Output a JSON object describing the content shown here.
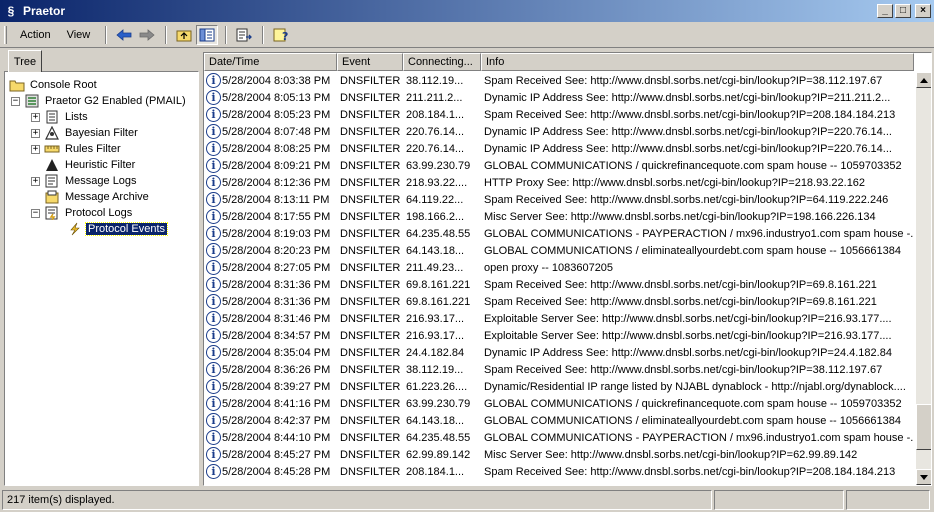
{
  "window": {
    "title": "Praetor",
    "minimize_label": "_",
    "maximize_label": "□",
    "close_label": "×"
  },
  "menu": {
    "action": "Action",
    "view": "View"
  },
  "toolbar_icons": [
    "back-arrow-icon",
    "forward-arrow-icon",
    "up-folder-icon",
    "show-hide-tree-icon",
    "export-list-icon",
    "help-icon"
  ],
  "tree": {
    "tab_label": "Tree",
    "nodes": [
      {
        "label": "Console Root",
        "icon": "folder-icon",
        "level": 0,
        "expander": ""
      },
      {
        "label": "Praetor G2 Enabled (PMAIL)",
        "icon": "server-icon",
        "level": 1,
        "expander": "−"
      },
      {
        "label": "Lists",
        "icon": "list-icon",
        "level": 2,
        "expander": "+"
      },
      {
        "label": "Bayesian Filter",
        "icon": "bayesian-icon",
        "level": 2,
        "expander": "+"
      },
      {
        "label": "Rules Filter",
        "icon": "rules-icon",
        "level": 2,
        "expander": "+"
      },
      {
        "label": "Heuristic Filter",
        "icon": "heuristic-icon",
        "level": 2,
        "expander": ""
      },
      {
        "label": "Message Logs",
        "icon": "log-icon",
        "level": 2,
        "expander": "+"
      },
      {
        "label": "Message Archive",
        "icon": "archive-icon",
        "level": 2,
        "expander": ""
      },
      {
        "label": "Protocol Logs",
        "icon": "protocol-log-icon",
        "level": 2,
        "expander": "−"
      },
      {
        "label": "Protocol Events",
        "icon": "lightning-icon",
        "level": 3,
        "expander": "",
        "selected": true
      }
    ]
  },
  "table": {
    "columns": [
      "Date/Time",
      "Event",
      "Connecting...",
      "Info"
    ],
    "rows": [
      [
        "5/28/2004 8:03:38 PM",
        "DNSFILTER",
        "38.112.19...",
        "Spam Received See: http://www.dnsbl.sorbs.net/cgi-bin/lookup?IP=38.112.197.67"
      ],
      [
        "5/28/2004 8:05:13 PM",
        "DNSFILTER",
        "211.211.2...",
        "Dynamic IP Address See: http://www.dnsbl.sorbs.net/cgi-bin/lookup?IP=211.211.2..."
      ],
      [
        "5/28/2004 8:05:23 PM",
        "DNSFILTER",
        "208.184.1...",
        "Spam Received See: http://www.dnsbl.sorbs.net/cgi-bin/lookup?IP=208.184.184.213"
      ],
      [
        "5/28/2004 8:07:48 PM",
        "DNSFILTER",
        "220.76.14...",
        "Dynamic IP Address See: http://www.dnsbl.sorbs.net/cgi-bin/lookup?IP=220.76.14..."
      ],
      [
        "5/28/2004 8:08:25 PM",
        "DNSFILTER",
        "220.76.14...",
        "Dynamic IP Address See: http://www.dnsbl.sorbs.net/cgi-bin/lookup?IP=220.76.14..."
      ],
      [
        "5/28/2004 8:09:21 PM",
        "DNSFILTER",
        "63.99.230.79",
        "GLOBAL COMMUNICATIONS / quickrefinancequote.com spam house -- 1059703352"
      ],
      [
        "5/28/2004 8:12:36 PM",
        "DNSFILTER",
        "218.93.22....",
        "HTTP Proxy See: http://www.dnsbl.sorbs.net/cgi-bin/lookup?IP=218.93.22.162"
      ],
      [
        "5/28/2004 8:13:11 PM",
        "DNSFILTER",
        "64.119.22...",
        "Spam Received See: http://www.dnsbl.sorbs.net/cgi-bin/lookup?IP=64.119.222.246"
      ],
      [
        "5/28/2004 8:17:55 PM",
        "DNSFILTER",
        "198.166.2...",
        "Misc Server See: http://www.dnsbl.sorbs.net/cgi-bin/lookup?IP=198.166.226.134"
      ],
      [
        "5/28/2004 8:19:03 PM",
        "DNSFILTER",
        "64.235.48.55",
        "GLOBAL COMMUNICATIONS - PAYPERACTION / mx96.industryo1.com spam house -..."
      ],
      [
        "5/28/2004 8:20:23 PM",
        "DNSFILTER",
        "64.143.18...",
        "GLOBAL COMMUNICATIONS / eliminateallyourdebt.com spam house -- 1056661384"
      ],
      [
        "5/28/2004 8:27:05 PM",
        "DNSFILTER",
        "211.49.23...",
        "open proxy -- 1083607205"
      ],
      [
        "5/28/2004 8:31:36 PM",
        "DNSFILTER",
        "69.8.161.221",
        "Spam Received See: http://www.dnsbl.sorbs.net/cgi-bin/lookup?IP=69.8.161.221"
      ],
      [
        "5/28/2004 8:31:36 PM",
        "DNSFILTER",
        "69.8.161.221",
        "Spam Received See: http://www.dnsbl.sorbs.net/cgi-bin/lookup?IP=69.8.161.221"
      ],
      [
        "5/28/2004 8:31:46 PM",
        "DNSFILTER",
        "216.93.17...",
        "Exploitable Server See: http://www.dnsbl.sorbs.net/cgi-bin/lookup?IP=216.93.177...."
      ],
      [
        "5/28/2004 8:34:57 PM",
        "DNSFILTER",
        "216.93.17...",
        "Exploitable Server See: http://www.dnsbl.sorbs.net/cgi-bin/lookup?IP=216.93.177...."
      ],
      [
        "5/28/2004 8:35:04 PM",
        "DNSFILTER",
        "24.4.182.84",
        "Dynamic IP Address See: http://www.dnsbl.sorbs.net/cgi-bin/lookup?IP=24.4.182.84"
      ],
      [
        "5/28/2004 8:36:26 PM",
        "DNSFILTER",
        "38.112.19...",
        "Spam Received See: http://www.dnsbl.sorbs.net/cgi-bin/lookup?IP=38.112.197.67"
      ],
      [
        "5/28/2004 8:39:27 PM",
        "DNSFILTER",
        "61.223.26....",
        "Dynamic/Residential IP range listed by NJABL dynablock - http://njabl.org/dynablock...."
      ],
      [
        "5/28/2004 8:41:16 PM",
        "DNSFILTER",
        "63.99.230.79",
        "GLOBAL COMMUNICATIONS / quickrefinancequote.com spam house -- 1059703352"
      ],
      [
        "5/28/2004 8:42:37 PM",
        "DNSFILTER",
        "64.143.18...",
        "GLOBAL COMMUNICATIONS / eliminateallyourdebt.com spam house -- 1056661384"
      ],
      [
        "5/28/2004 8:44:10 PM",
        "DNSFILTER",
        "64.235.48.55",
        "GLOBAL COMMUNICATIONS - PAYPERACTION / mx96.industryo1.com spam house -..."
      ],
      [
        "5/28/2004 8:45:27 PM",
        "DNSFILTER",
        "62.99.89.142",
        "Misc Server See: http://www.dnsbl.sorbs.net/cgi-bin/lookup?IP=62.99.89.142"
      ],
      [
        "5/28/2004 8:45:28 PM",
        "DNSFILTER",
        "208.184.1...",
        "Spam Received See: http://www.dnsbl.sorbs.net/cgi-bin/lookup?IP=208.184.184.213"
      ]
    ]
  },
  "status": {
    "items_displayed": "217 item(s) displayed."
  }
}
